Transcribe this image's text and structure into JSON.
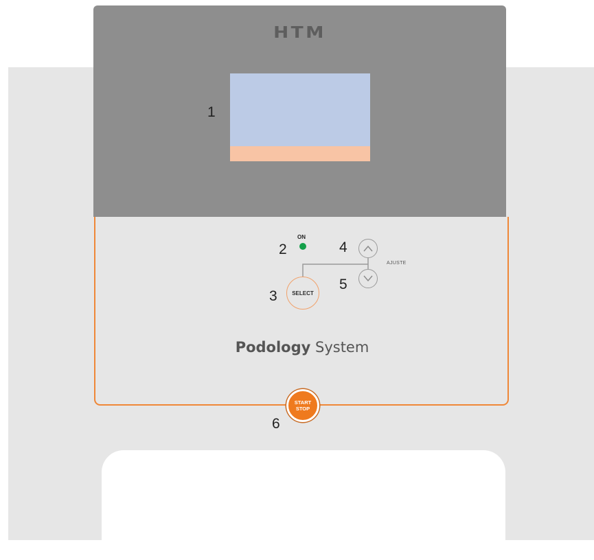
{
  "brand": {
    "logo_text": "HTM"
  },
  "callouts": {
    "c1": "1",
    "c2": "2",
    "c3": "3",
    "c4": "4",
    "c5": "5",
    "c6": "6"
  },
  "controls": {
    "on_label": "ON",
    "select_label": "SELECT",
    "ajuste_label": "AJUSTE",
    "start_label": "START",
    "stop_label": "STOP"
  },
  "product": {
    "name_bold": "Podology",
    "name_light": "System"
  },
  "colors": {
    "panel_gray": "#8e8e8e",
    "body_gray": "#e6e6e6",
    "screen_blue": "#bccbe6",
    "screen_peach": "#f8c4a5",
    "accent_orange": "#ef7a1e",
    "led_green": "#13a04a"
  },
  "icons": {
    "up": "chevron-up-icon",
    "down": "chevron-down-icon"
  }
}
